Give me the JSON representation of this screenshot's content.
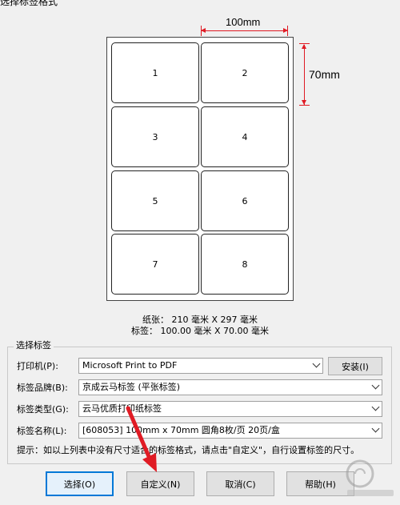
{
  "window": {
    "title": "选择标签格式"
  },
  "preview": {
    "dim_width": "100mm",
    "dim_height": "70mm",
    "labels": [
      "1",
      "2",
      "3",
      "4",
      "5",
      "6",
      "7",
      "8"
    ],
    "accent": "#e01b24"
  },
  "info": {
    "paper": "纸张： 210 毫米 X 297 毫米",
    "label": "标签： 100.00 毫米 X 70.00 毫米"
  },
  "group": {
    "title": "选择标签",
    "printer_label": "打印机(P):",
    "printer_value": "Microsoft Print to PDF",
    "install_button": "安装(I)",
    "brand_label": "标签品牌(B):",
    "brand_value": "京成云马标签 (平张标签)",
    "type_label": "标签类型(G):",
    "type_value": "云马优质打印纸标签",
    "name_label": "标签名称(L):",
    "name_value": "[608053] 100mm x 70mm 圆角8枚/页 20页/盒",
    "hint": "提示：如以上列表中没有尺寸适合的标签格式，请点击\"自定义\"，自行设置标签的尺寸。"
  },
  "buttons": {
    "select": "选择(O)",
    "custom": "自定义(N)",
    "cancel": "取消(C)",
    "help": "帮助(H)"
  }
}
